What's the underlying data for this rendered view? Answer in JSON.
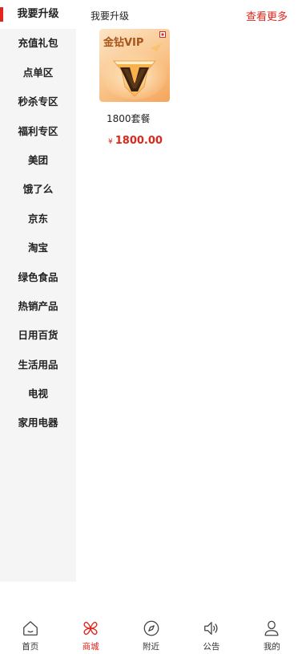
{
  "sidebar": {
    "items": [
      {
        "label": "我要升级"
      },
      {
        "label": "充值礼包"
      },
      {
        "label": "点单区"
      },
      {
        "label": "秒杀专区"
      },
      {
        "label": "福利专区"
      },
      {
        "label": "美团"
      },
      {
        "label": "饿了么"
      },
      {
        "label": "京东"
      },
      {
        "label": "淘宝"
      },
      {
        "label": "绿色食品"
      },
      {
        "label": "热销产品"
      },
      {
        "label": "日用百货"
      },
      {
        "label": "生活用品"
      },
      {
        "label": "电视"
      },
      {
        "label": "家用电器"
      }
    ],
    "active_index": 0
  },
  "main": {
    "section_title": "我要升级",
    "see_more": "查看更多",
    "products": [
      {
        "thumb_text": "金钻VIP",
        "name": "1800套餐",
        "currency": "¥",
        "price": "1800.00"
      }
    ]
  },
  "bottom_nav": {
    "items": [
      {
        "label": "首页",
        "icon": "home-icon"
      },
      {
        "label": "商城",
        "icon": "mall-icon"
      },
      {
        "label": "附近",
        "icon": "compass-icon"
      },
      {
        "label": "公告",
        "icon": "speaker-icon"
      },
      {
        "label": "我的",
        "icon": "user-icon"
      }
    ],
    "active_index": 1
  },
  "colors": {
    "accent": "#e0261d",
    "sidebar_bg": "#f5f5f5"
  }
}
